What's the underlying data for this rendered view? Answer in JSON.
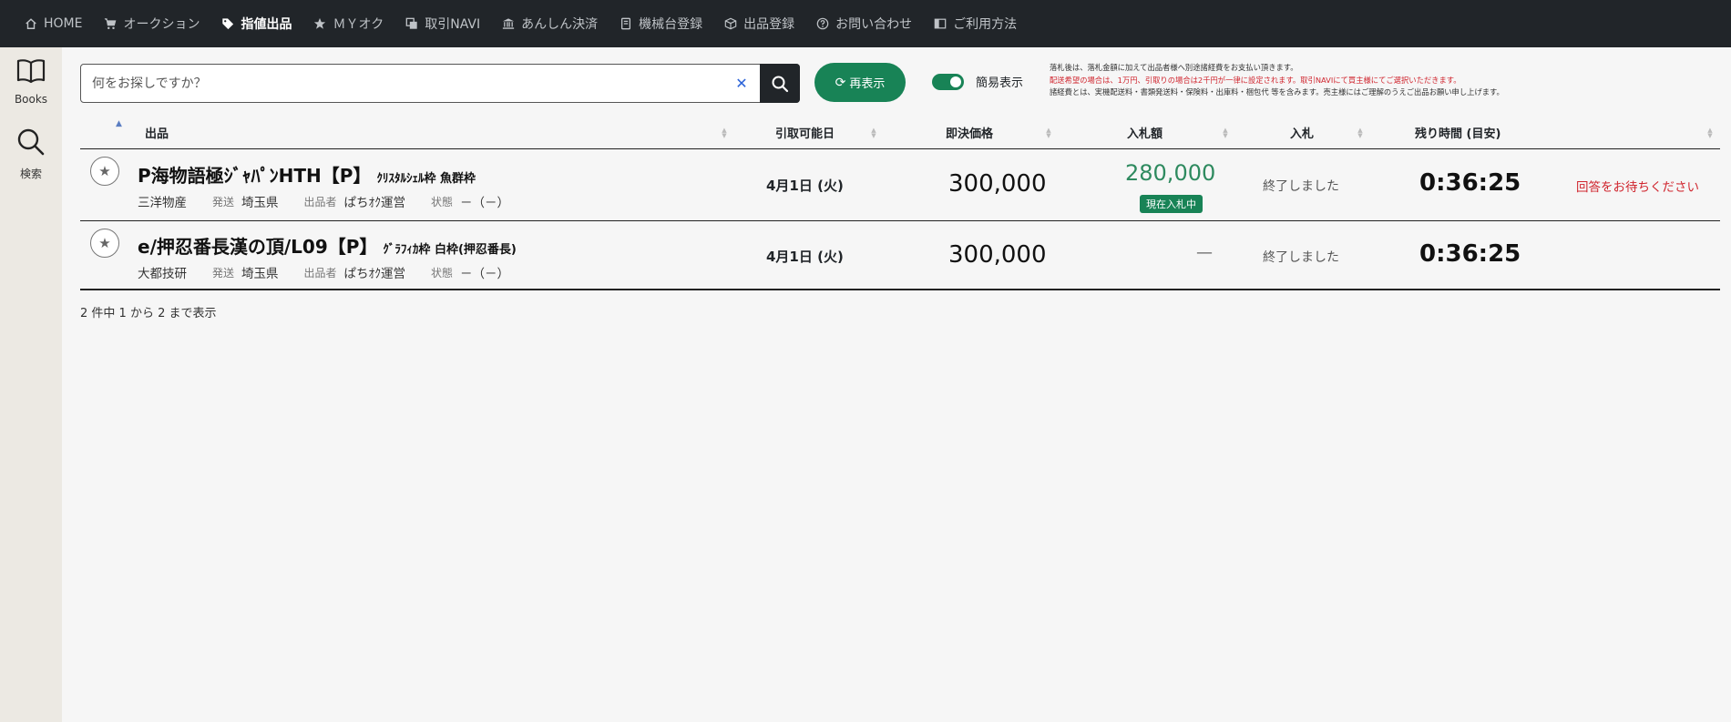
{
  "nav": {
    "items": [
      {
        "label": "HOME",
        "icon": "home-icon"
      },
      {
        "label": "オークション",
        "icon": "cart-icon"
      },
      {
        "label": "指値出品",
        "icon": "tag-icon"
      },
      {
        "label": "ＭＹオク",
        "icon": "star-icon"
      },
      {
        "label": "取引NAVI",
        "icon": "copy-icon"
      },
      {
        "label": "あんしん決済",
        "icon": "bank-icon"
      },
      {
        "label": "機械台登録",
        "icon": "book-icon"
      },
      {
        "label": "出品登録",
        "icon": "box-icon"
      },
      {
        "label": "お問い合わせ",
        "icon": "question-icon"
      },
      {
        "label": "ご利用方法",
        "icon": "guide-icon"
      }
    ],
    "active": "指値出品"
  },
  "sidebar": {
    "books_label": "Books",
    "search_label": "検索"
  },
  "search": {
    "placeholder": "何をお探しですか？",
    "value": ""
  },
  "toolbar": {
    "refresh_label": "再表示",
    "toggle_label": "簡易表示",
    "toggle_on": true
  },
  "notice": {
    "line1": "落札後は、落札金額に加えて出品者様へ別途諸経費をお支払い頂きます。",
    "line2": "配送希望の場合は、1万円、引取りの場合は2千円が一律に設定されます。取引NAVIにて買主様にてご選択いただきます。",
    "line3": "諸経費とは、実機配送料・書類発送料・保険料・出庫料・梱包代 等を含みます。売主様にはご理解のうえご出品お願い申し上げます。"
  },
  "table": {
    "headers": {
      "item": "出品",
      "pickup": "引取可能日",
      "buyout": "即決価格",
      "bid_amount": "入札額",
      "bid": "入札",
      "remaining": "残り時間 (目安)"
    },
    "rows": [
      {
        "title": "P海物語極ｼﾞｬﾊﾟﾝHTH【P】",
        "subtitle": "ｸﾘｽﾀﾙｼｪﾙ枠 魚群枠",
        "maker": "三洋物産",
        "ship_key": "発送",
        "ship_val": "埼玉県",
        "seller_key": "出品者",
        "seller_val": "ぱちｵｸ運営",
        "state_key": "状態",
        "state_val": "－（－）",
        "pickup_date": "4月1日 (火)",
        "buyout": "300,000",
        "bid_amount": "280,000",
        "bid_badge": "現在入札中",
        "bid_status": "終了しました",
        "remaining": "0:36:25",
        "note": "回答をお待ちください"
      },
      {
        "title": "e/押忍番長漢の頂/L09【P】",
        "subtitle": "ｸﾞﾗﾌｨｶ枠 白枠(押忍番長)",
        "maker": "大都技研",
        "ship_key": "発送",
        "ship_val": "埼玉県",
        "seller_key": "出品者",
        "seller_val": "ぱちｵｸ運営",
        "state_key": "状態",
        "state_val": "－（－）",
        "pickup_date": "4月1日 (火)",
        "buyout": "300,000",
        "bid_amount": "—",
        "bid_status": "終了しました",
        "remaining": "0:36:25",
        "note": ""
      }
    ],
    "footer": "2 件中 1 から 2 まで表示"
  },
  "colors": {
    "nav_bg": "#212529",
    "accent_green": "#188356",
    "bid_green": "#2e8a5f",
    "alert_red": "#d0262f"
  }
}
